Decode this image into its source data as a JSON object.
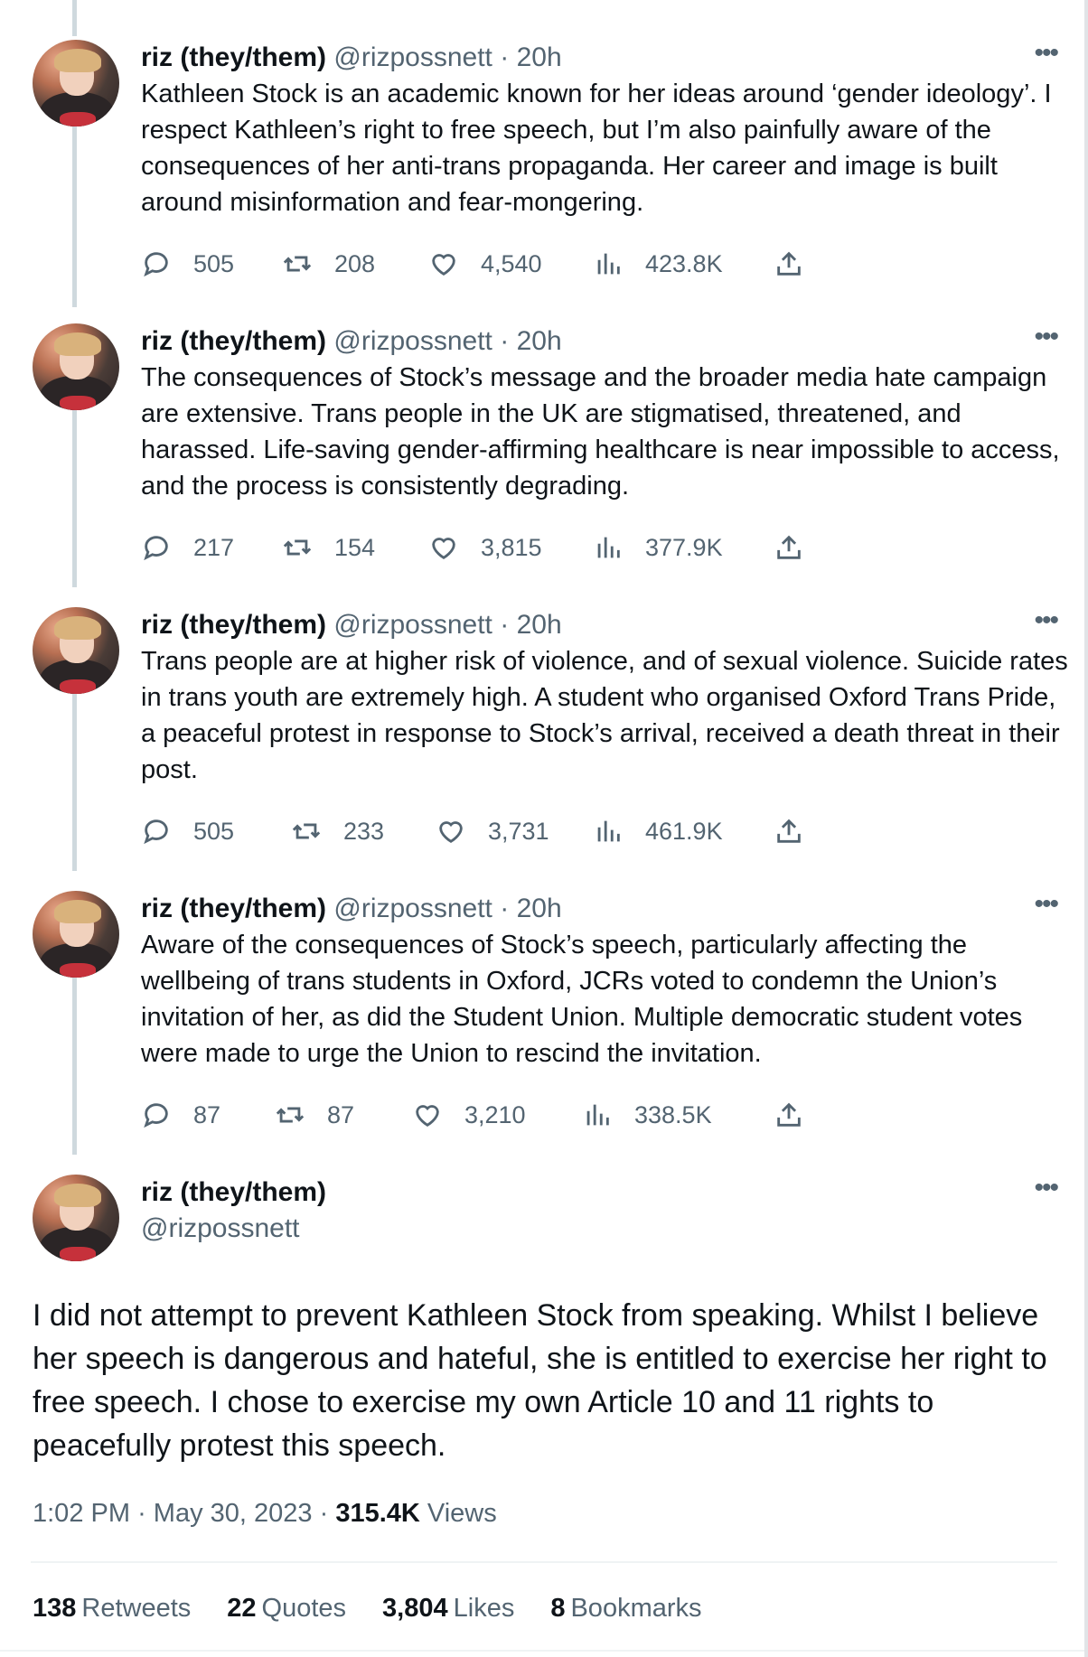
{
  "thread": [
    {
      "name": "riz (they/them)",
      "handle": "@rizpossnett",
      "sep": "·",
      "time": "20h",
      "more": "•••",
      "text": "Kathleen Stock is an academic known for her ideas around ‘gender ideology’. I respect Kathleen’s right to free speech, but I’m also painfully aware of the consequences of her anti-trans propaganda. Her career and image is built around misinformation and fear-mongering.",
      "replies": "505",
      "retweets": "208",
      "likes": "4,540",
      "views": "423.8K"
    },
    {
      "name": "riz (they/them)",
      "handle": "@rizpossnett",
      "sep": "·",
      "time": "20h",
      "more": "•••",
      "text": "The consequences of Stock’s message and the broader media hate campaign are extensive. Trans people in the UK are stigmatised, threatened, and harassed. Life-saving gender-affirming healthcare is near impossible to access, and the process is consistently degrading.",
      "replies": "217",
      "retweets": "154",
      "likes": "3,815",
      "views": "377.9K"
    },
    {
      "name": "riz (they/them)",
      "handle": "@rizpossnett",
      "sep": "·",
      "time": "20h",
      "more": "•••",
      "text": "Trans people are at higher risk of violence, and of sexual violence. Suicide rates in trans youth are extremely high. A student who organised Oxford Trans Pride, a peaceful protest in response to Stock’s arrival, received a death threat in their post.",
      "replies": "505",
      "retweets": "233",
      "likes": "3,731",
      "views": "461.9K"
    },
    {
      "name": "riz (they/them)",
      "handle": "@rizpossnett",
      "sep": "·",
      "time": "20h",
      "more": "•••",
      "text": "Aware of the consequences of Stock’s speech, particularly affecting the wellbeing of trans students in Oxford, JCRs voted to condemn the Union’s invitation of her, as did the Student Union. Multiple democratic student votes were made to urge the Union to rescind the invitation.",
      "replies": "87",
      "retweets": "87",
      "likes": "3,210",
      "views": "338.5K"
    }
  ],
  "main_tweet": {
    "name": "riz (they/them)",
    "handle": "@rizpossnett",
    "more": "•••",
    "text": "I did not attempt to prevent Kathleen Stock from speaking. Whilst I believe her speech is dangerous and hateful, she is entitled to exercise her right to free speech. I chose to exercise my own Article 10 and 11 rights to peacefully protest this speech.",
    "time": "1:02 PM",
    "sep": "·",
    "date": "May 30, 2023",
    "views_count": "315.4K",
    "views_label": "Views",
    "stats": {
      "retweets_count": "138",
      "retweets_label": "Retweets",
      "quotes_count": "22",
      "quotes_label": "Quotes",
      "likes_count": "3,804",
      "likes_label": "Likes",
      "bookmarks_count": "8",
      "bookmarks_label": "Bookmarks"
    }
  },
  "colors": {
    "text": "#0f1419",
    "secondary": "#536471",
    "thread_line": "#cfd9de",
    "divider": "#eff3f4"
  }
}
